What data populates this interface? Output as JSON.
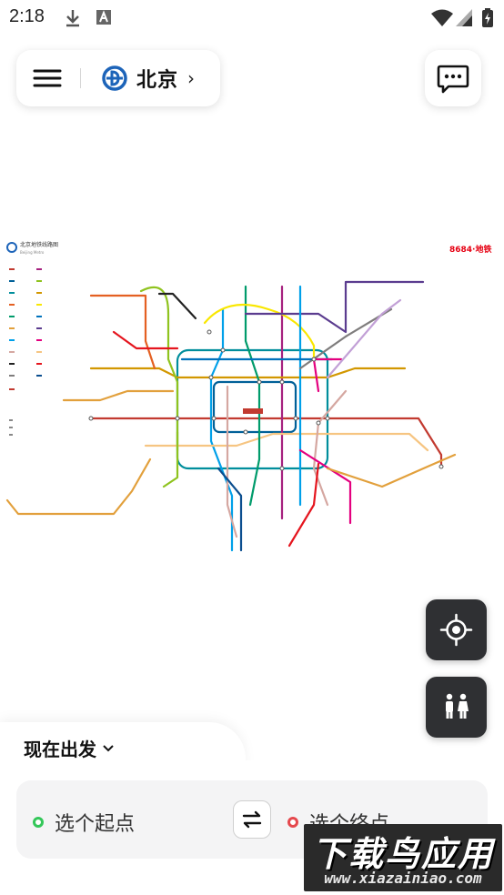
{
  "status_bar": {
    "time": "2:18",
    "icons": [
      "download-icon",
      "a11y-a-icon",
      "wifi-icon",
      "signal-icon",
      "battery-charging-icon"
    ]
  },
  "top_bar": {
    "menu_icon": "hamburger-menu-icon",
    "city_logo": "beijing-subway-logo",
    "city_name": "北京",
    "city_chevron": "›",
    "message_icon": "chat-bubble-icon"
  },
  "map": {
    "title": "北京地铁线路图",
    "subtitle": "Beijing Metro",
    "brand": "8684·地铁",
    "line_colors": [
      "#c23a30",
      "#006098",
      "#008e9c",
      "#e46022",
      "#a6217f",
      "#d29700",
      "#f6c582",
      "#009b6b",
      "#8fc31f",
      "#d5a7a1",
      "#e2a03c",
      "#00a0e9",
      "#f9e700",
      "#5b3c8f",
      "#0072bc",
      "#e4007f",
      "#e5151e",
      "#222222",
      "#7f7d7d",
      "#0b4e8f"
    ]
  },
  "fab": {
    "locate_icon": "locate-crosshair-icon",
    "nearby_icon": "restroom-icon"
  },
  "planner": {
    "depart_label": "现在出发",
    "depart_chevron": "⌄",
    "start_label": "选个起点",
    "end_label": "选个终点",
    "swap_icon": "swap-arrows-icon",
    "start_color": "#34c759",
    "end_color": "#e5484d"
  },
  "watermark": {
    "title": "下载鸟应用",
    "url": "www.xiazainiao.com"
  }
}
